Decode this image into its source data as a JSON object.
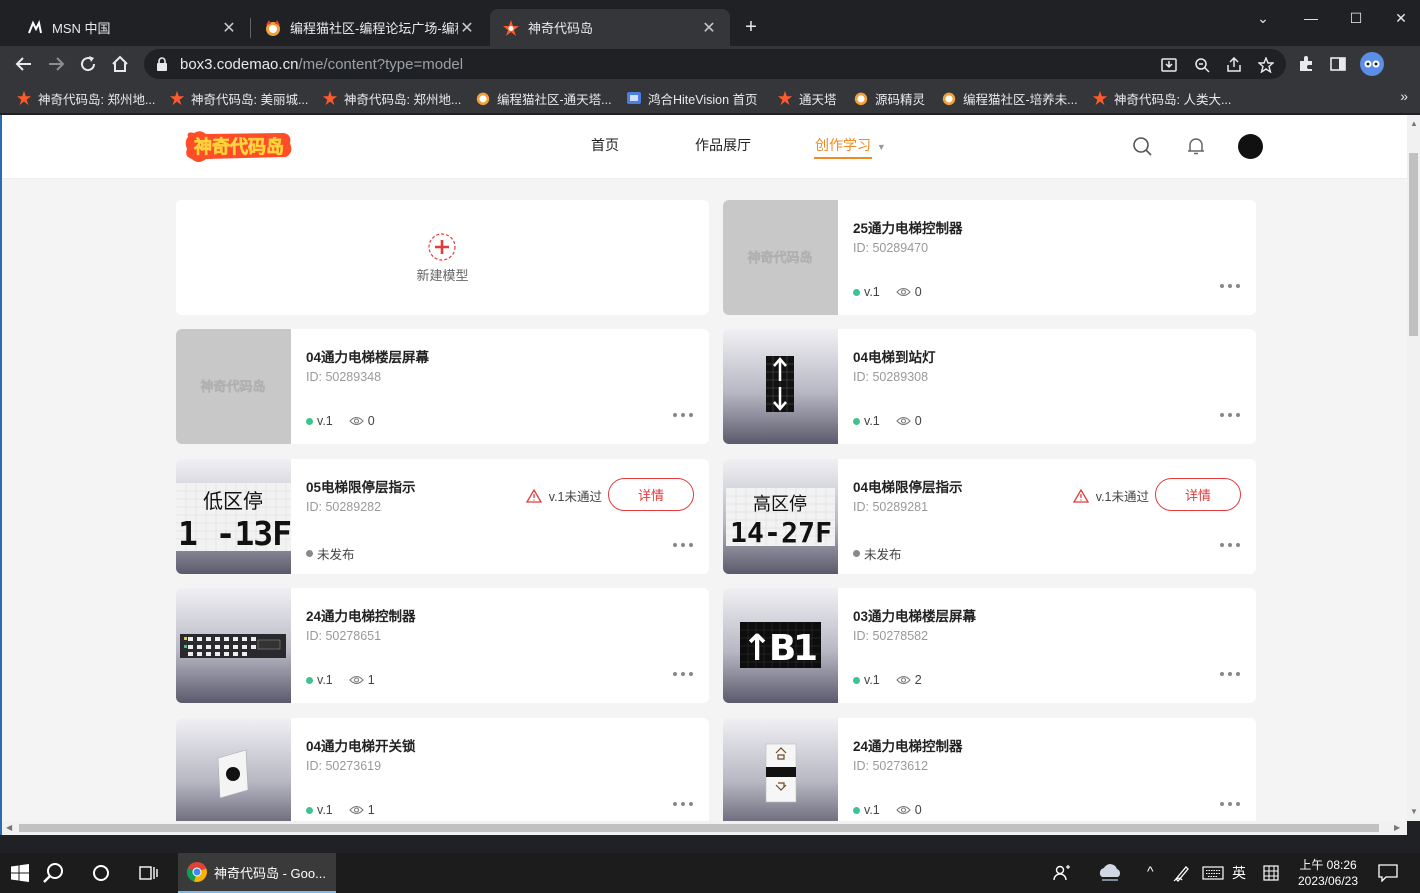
{
  "browser": {
    "tabs": [
      {
        "title": "MSN 中国",
        "icon": "msn-icon"
      },
      {
        "title": "编程猫社区-编程论坛广场-编程学",
        "icon": "codemao-cat-icon"
      },
      {
        "title": "神奇代码岛",
        "icon": "codemao-star-icon"
      }
    ],
    "url_host": "box3.codemao.cn",
    "url_path": "/me/content?type=model",
    "bookmarks": [
      "神奇代码岛: 郑州地...",
      "神奇代码岛: 美丽城...",
      "神奇代码岛: 郑州地...",
      "编程猫社区-通天塔...",
      "鸿合HiteVision 首页",
      "通天塔",
      "源码精灵",
      "编程猫社区-培养未...",
      "神奇代码岛: 人类大..."
    ],
    "bookmarks_more": "»",
    "new_tab": "+",
    "window_controls": {
      "minimize": "—",
      "maximize": "☐",
      "close": "✕",
      "tab_search": "⌄"
    }
  },
  "site": {
    "logo_text": "神奇代码岛",
    "nav": [
      "首页",
      "作品展厅",
      "创作学习"
    ]
  },
  "new_model": {
    "label": "新建模型"
  },
  "models": [
    {
      "name": "25通力电梯控制器",
      "id": "ID: 50289470",
      "version": "v.1",
      "views": "0",
      "published": true,
      "thumb": "logo"
    },
    {
      "name": "04通力电梯楼层屏幕",
      "id": "ID: 50289348",
      "version": "v.1",
      "views": "0",
      "published": true,
      "thumb": "logo"
    },
    {
      "name": "04电梯到站灯",
      "id": "ID: 50289308",
      "version": "v.1",
      "views": "0",
      "published": true,
      "thumb": "arrows"
    },
    {
      "name": "05电梯限停层指示",
      "id": "ID: 50289282",
      "status": "未发布",
      "published": false,
      "review": "v.1未通过",
      "detail": "详情",
      "thumb": "low",
      "thumb_text": [
        "低区停",
        "1 -13F"
      ]
    },
    {
      "name": "04电梯限停层指示",
      "id": "ID: 50289281",
      "status": "未发布",
      "published": false,
      "review": "v.1未通过",
      "detail": "详情",
      "thumb": "high",
      "thumb_text": [
        "高区停",
        "14-27F"
      ]
    },
    {
      "name": "24通力电梯控制器",
      "id": "ID: 50278651",
      "version": "v.1",
      "views": "1",
      "published": true,
      "thumb": "panel"
    },
    {
      "name": "03通力电梯楼层屏幕",
      "id": "ID: 50278582",
      "version": "v.1",
      "views": "2",
      "published": true,
      "thumb": "b1",
      "thumb_text": [
        "↑B1"
      ]
    },
    {
      "name": "04通力电梯开关锁",
      "id": "ID: 50273619",
      "version": "v.1",
      "views": "1",
      "published": true,
      "thumb": "lock"
    },
    {
      "name": "24通力电梯控制器",
      "id": "ID: 50273612",
      "version": "v.1",
      "views": "0",
      "published": true,
      "thumb": "buttons"
    }
  ],
  "taskbar": {
    "app_title": "神奇代码岛 - Goo...",
    "ime": "英",
    "clock_period_time": "上午 08:26",
    "clock_date": "2023/06/23"
  }
}
